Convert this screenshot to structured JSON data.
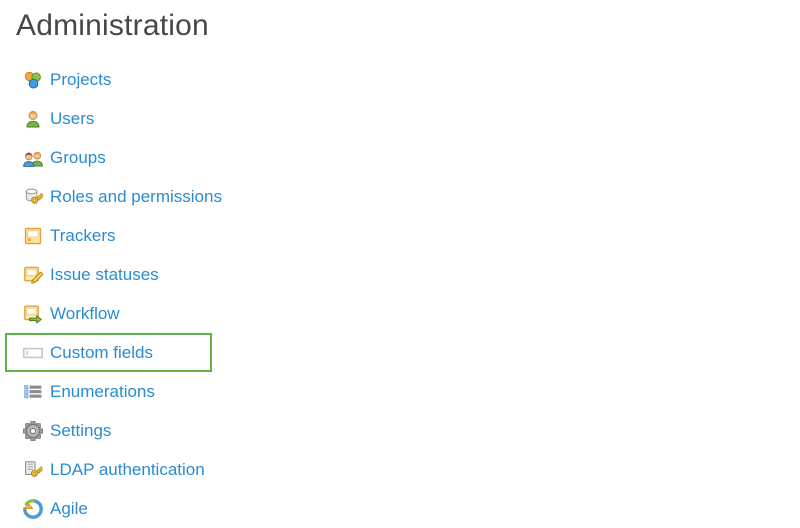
{
  "page": {
    "title": "Administration",
    "link_color": "#2a8bd0",
    "title_color": "#474747",
    "highlight_color": "#5fb248",
    "background_color": "#ffffff"
  },
  "menu": {
    "items": [
      {
        "label": "Projects",
        "icon": "projects-icon",
        "highlighted": false
      },
      {
        "label": "Users",
        "icon": "user-icon",
        "highlighted": false
      },
      {
        "label": "Groups",
        "icon": "group-icon",
        "highlighted": false
      },
      {
        "label": "Roles and permissions",
        "icon": "roles-key-icon",
        "highlighted": false
      },
      {
        "label": "Trackers",
        "icon": "tracker-icon",
        "highlighted": false
      },
      {
        "label": "Issue statuses",
        "icon": "issue-status-icon",
        "highlighted": false
      },
      {
        "label": "Workflow",
        "icon": "workflow-icon",
        "highlighted": false
      },
      {
        "label": "Custom fields",
        "icon": "custom-field-icon",
        "highlighted": true
      },
      {
        "label": "Enumerations",
        "icon": "list-icon",
        "highlighted": false
      },
      {
        "label": "Settings",
        "icon": "gear-icon",
        "highlighted": false
      },
      {
        "label": "LDAP authentication",
        "icon": "ldap-server-icon",
        "highlighted": false
      },
      {
        "label": "Agile",
        "icon": "agile-refresh-icon",
        "highlighted": false
      }
    ]
  }
}
